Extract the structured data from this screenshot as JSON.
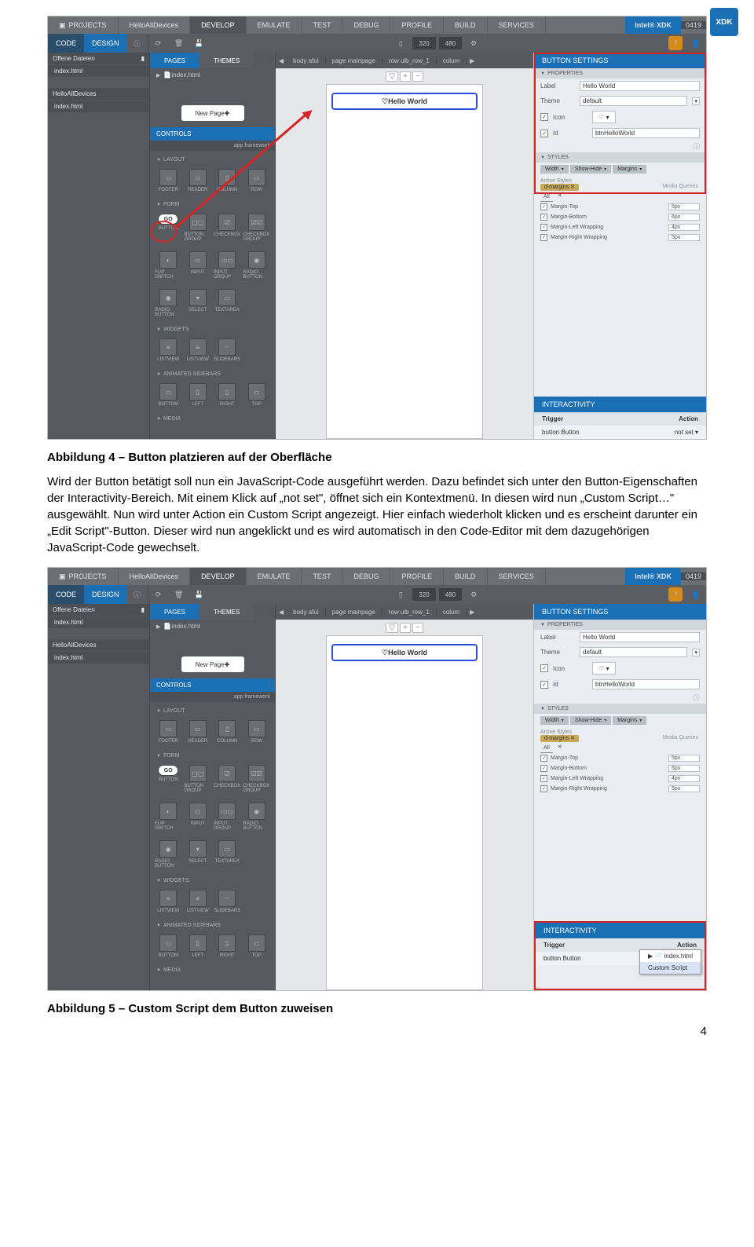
{
  "logo": "XDK",
  "caption1": "Abbildung 4 – Button platzieren auf der Oberfläche",
  "para1": "Wird der Button betätigt soll nun ein JavaScript-Code ausgeführt werden. Dazu befindet sich unter den Button-Eigenschaften der Interactivity-Bereich. Mit einem Klick auf „not set\", öffnet sich ein Kontextmenü. In diesen wird nun „Custom Script…\" ausgewählt. Nun wird unter Action ein Custom Script angezeigt. Hier einfach wiederholt klicken und es erscheint darunter ein „Edit Script\"-Button. Dieser wird nun angeklickt und es wird automatisch in den Code-Editor mit dem dazugehörigen JavaScript-Code gewechselt.",
  "caption2": "Abbildung 5 – Custom Script dem Button zuweisen",
  "pagenum": "4",
  "top": {
    "projects": "PROJECTS",
    "project_name": "HelloAllDevices",
    "tabs": [
      "DEVELOP",
      "EMULATE",
      "TEST",
      "DEBUG",
      "PROFILE",
      "BUILD",
      "SERVICES"
    ],
    "brand_pre": "Intel®",
    "brand": "XDK",
    "version": "0419"
  },
  "bar2": {
    "code": "CODE",
    "design": "DESIGN",
    "w": "320",
    "h": "480"
  },
  "left": {
    "hd1": "Offene Dateien",
    "file1": "index.html",
    "hd2": "HelloAllDevices",
    "file2": "index.html"
  },
  "mid1": {
    "tab_pages": "PAGES",
    "tab_themes": "THEMES",
    "index": "index.html",
    "newpage": "New Page",
    "controls": "CONTROLS",
    "appfw": "app framework",
    "sub_layout": "LAYOUT",
    "layout": [
      "FOOTER",
      "HEADER",
      "COLUMN",
      "ROW"
    ],
    "sub_form": "FORM",
    "form_r1": [
      "BUTTON",
      "BUTTON GROUP",
      "CHECKBOX",
      "CHECKBOX GROUP"
    ],
    "form_r2": [
      "FLIP SWITCH",
      "INPUT",
      "INPUT GROUP",
      "RADIO BUTTON"
    ],
    "form_r3": [
      "RADIO BUTTON",
      "SELECT",
      "TEXTAREA",
      ""
    ],
    "go": "GO",
    "sub_widgets": "WIDGETS",
    "widgets": [
      "LISTVIEW",
      "LISTVIEW",
      "SLIDEBARS"
    ],
    "sub_sidebars": "ANIMATED SIDEBARS",
    "sidebars": [
      "BOTTOM",
      "LEFT",
      "RIGHT",
      "TOP"
    ],
    "sub_media": "MEDIA"
  },
  "center": {
    "path": [
      "body afui",
      "page mainpage",
      "row uib_row_1",
      "colum"
    ],
    "hello": "Hello World"
  },
  "right": {
    "bs": "BUTTON SETTINGS",
    "props": "PROPERTIES",
    "label": "Label",
    "label_v": "Hello World",
    "theme": "Theme",
    "theme_v": "default",
    "icon": "Icon",
    "id": "Id",
    "id_v": "btnHelloWorld",
    "styles": "STYLES",
    "sb": [
      "Width",
      "Show-Hide",
      "Margins"
    ],
    "active": "Active Styles",
    "active_tag": "d-margins",
    "media": "Media Queries",
    "tab_all": "All",
    "m1": "Margin-Top",
    "m1v": "5px",
    "m2": "Margin-Bottom",
    "m2v": "6px",
    "m3": "Margin-Left Wrapping",
    "m3v": "4px",
    "m4": "Margin-Right Wrapping",
    "m4v": "5px",
    "inter": "INTERACTIVITY",
    "trigger": "Trigger",
    "action": "Action",
    "trig_v": "button Button",
    "act_v1": "not set",
    "act_v2": "not s",
    "pop_line1": "index.html",
    "pop_line2": "Custom Script"
  }
}
